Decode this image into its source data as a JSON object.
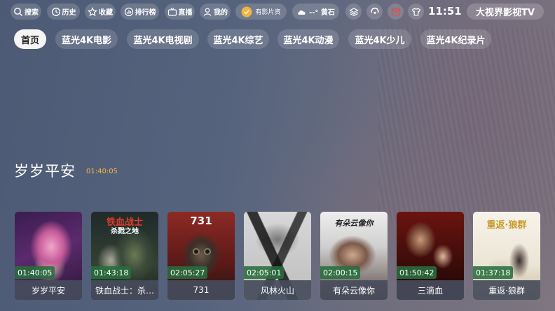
{
  "topbar": {
    "search": "搜索",
    "history": "历史",
    "favorites": "收藏",
    "ranking": "排行榜",
    "live": "直播",
    "mine": "我的",
    "source": "有影片资",
    "weather": "--° 黄石",
    "clock": "11:51",
    "brand": "大视界影视TV"
  },
  "tabs": [
    "首页",
    "蓝光4K电影",
    "蓝光4K电视剧",
    "蓝光4K综艺",
    "蓝光4K动漫",
    "蓝光4K少儿",
    "蓝光4K纪录片"
  ],
  "featured": {
    "title": "岁岁平安",
    "duration": "01:40:05"
  },
  "cards": [
    {
      "title": "岁岁平安",
      "duration": "01:40:05",
      "poster_text": ""
    },
    {
      "title": "铁血战士：杀…",
      "duration": "01:43:18",
      "poster_text": "铁血战士",
      "poster_sub": "杀戮之地"
    },
    {
      "title": "731",
      "duration": "02:05:27",
      "poster_text": "731"
    },
    {
      "title": "风林火山",
      "duration": "02:05:01",
      "poster_text": ""
    },
    {
      "title": "有朵云像你",
      "duration": "02:00:15",
      "poster_text": "有朵云像你"
    },
    {
      "title": "三滴血",
      "duration": "01:50:42",
      "poster_text": ""
    },
    {
      "title": "重返·狼群",
      "duration": "01:37:18",
      "poster_text": "重返·狼群"
    }
  ]
}
